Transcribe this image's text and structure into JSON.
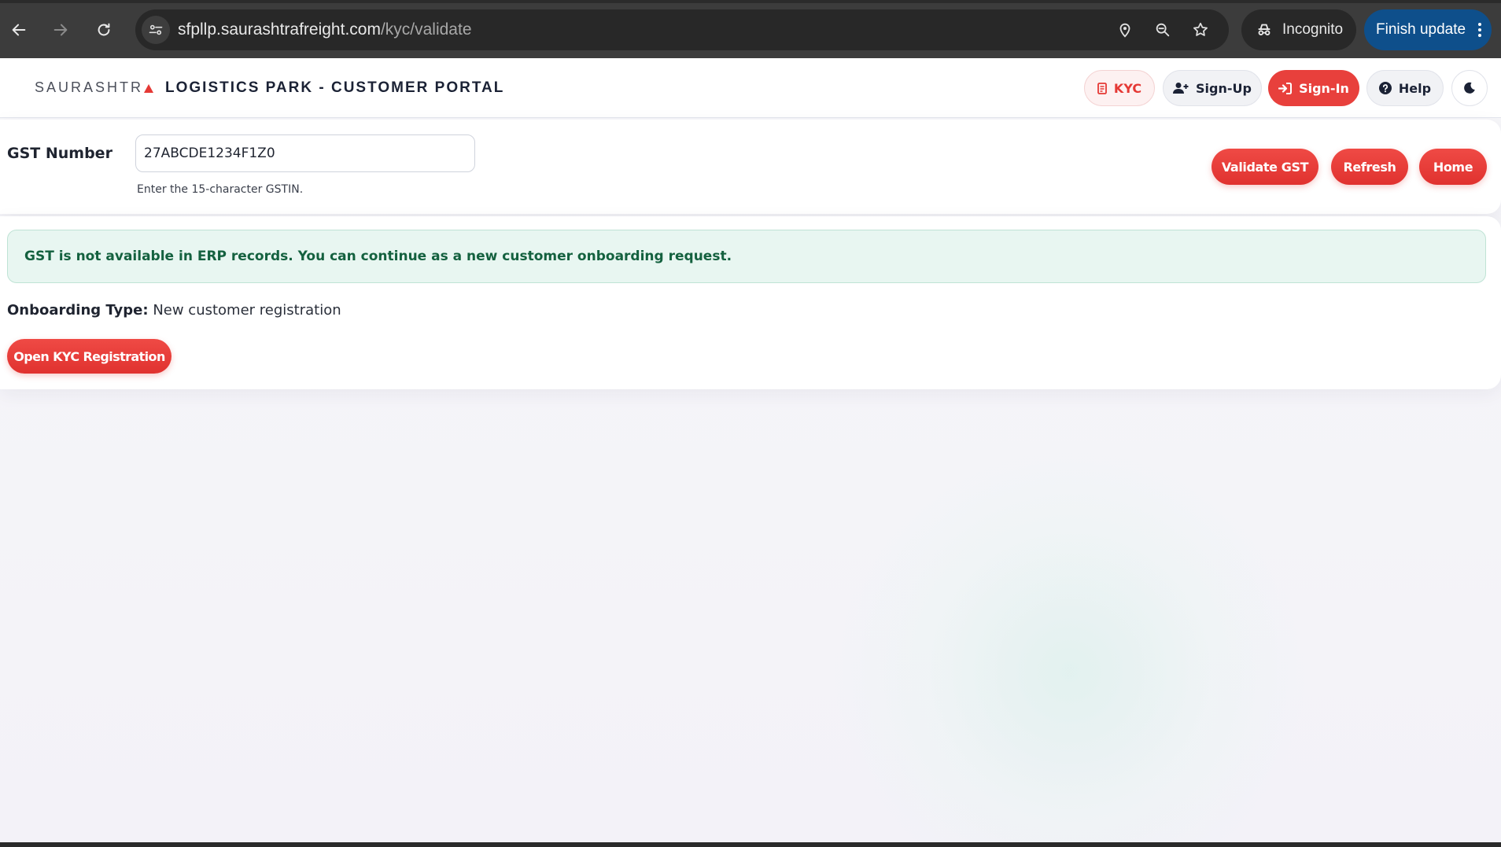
{
  "browser": {
    "url_host": "sfpllp.saurashtrafreight.com",
    "url_path": "/kyc/validate",
    "incognito_label": "Incognito",
    "finish_update_label": "Finish update",
    "icons": [
      "back-icon",
      "forward-icon",
      "reload-icon",
      "site-info-icon",
      "location-icon",
      "zoom-icon",
      "bookmark-star-icon",
      "incognito-icon",
      "kebab-menu-icon"
    ]
  },
  "header": {
    "brand": "SAURASHTR",
    "portal_title": "LOGISTICS PARK - CUSTOMER PORTAL",
    "nav": {
      "kyc": "KYC",
      "signup": "Sign-Up",
      "signin": "Sign-In",
      "help": "Help"
    },
    "icons": [
      "document-icon",
      "user-plus-icon",
      "sign-in-icon",
      "question-icon",
      "moon-icon"
    ]
  },
  "gst_form": {
    "label": "GST Number",
    "value": "27ABCDE1234F1Z0",
    "hint": "Enter the 15-character GSTIN.",
    "validate_label": "Validate GST",
    "refresh_label": "Refresh",
    "home_label": "Home"
  },
  "result": {
    "alert": "GST is not available in ERP records. You can continue as a new customer onboarding request.",
    "onboarding_type_label": "Onboarding Type:",
    "onboarding_type_value": "New customer registration",
    "open_kyc_label": "Open KYC Registration"
  },
  "colors": {
    "accent_red": "#e8403c",
    "alert_bg": "#e8f6f1",
    "alert_text": "#14613f",
    "update_blue": "#0e4f8b"
  }
}
